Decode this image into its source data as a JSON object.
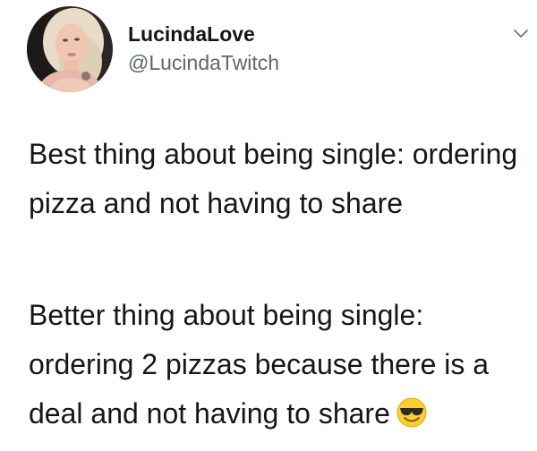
{
  "author": {
    "display_name": "LucindaLove",
    "handle": "@LucindaTwitch"
  },
  "menu": {
    "icon": "chevron-down-icon"
  },
  "tweet": {
    "paragraphs": [
      "Best thing about being single: ordering pizza and not having to share",
      "Better thing about being single: ordering 2 pizzas because there is a deal and not having to share"
    ],
    "trailing_emoji": "smiling-face-with-sunglasses-emoji"
  },
  "colors": {
    "text": "#14171a",
    "secondary_text": "#5b6770",
    "background": "#ffffff"
  }
}
